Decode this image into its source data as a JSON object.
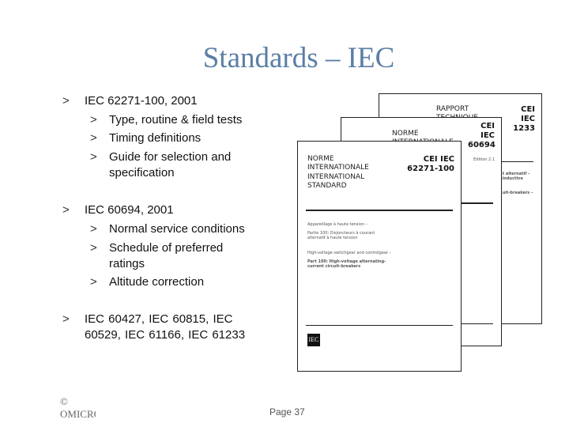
{
  "title": "Standards – IEC",
  "bullets": [
    {
      "text": "IEC 62271-100, 2001",
      "subs": [
        "Type, routine & field tests",
        "Timing definitions",
        "Guide for selection and specification"
      ]
    },
    {
      "text": "IEC 60694, 2001",
      "subs": [
        "Normal service conditions",
        "Schedule of preferred ratings",
        "Altitude correction"
      ]
    },
    {
      "text": "IEC 60427, IEC 60815, IEC 60529, IEC 61166, IEC 61233"
    }
  ],
  "marker": ">",
  "docs": {
    "back": {
      "heading": "RAPPORT TECHNIQUE",
      "code": "CEI IEC 1233",
      "snippets": [
        "...t alternatif – ...inductive",
        "...uit-breakers –"
      ]
    },
    "middle": {
      "heading": "NORME INTERNATIONALE",
      "code": "CEI IEC 60694",
      "edition": "Edition 2.1"
    },
    "front": {
      "heading1": "NORME INTERNATIONALE",
      "heading2": "INTERNATIONAL STANDARD",
      "code": "CEI IEC 62271-100",
      "fr_title": "Appareillage à haute tension –",
      "fr_part": "Partie 100: Disjoncteurs à courant alternatif à haute tension",
      "en_title": "High-voltage switchgear and controlgear –",
      "en_part": "Part 100: High-voltage alternating-current circuit-breakers",
      "logo": "IEC"
    }
  },
  "footer": {
    "copyright": "© OMICRON",
    "page": "Page 37"
  }
}
